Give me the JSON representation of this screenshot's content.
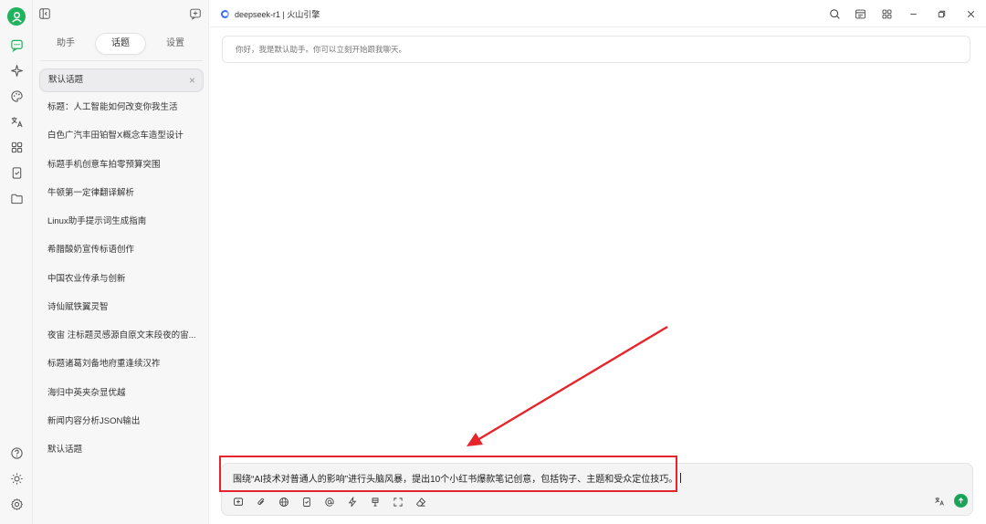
{
  "titlebar": {
    "model_name": "deepseek-r1 | 火山引擎",
    "model_dot_color": "#3b6cf6"
  },
  "sidebar": {
    "tabs": [
      {
        "label": "助手"
      },
      {
        "label": "话题",
        "active": true
      },
      {
        "label": "设置"
      }
    ],
    "topics": [
      {
        "label": "默认话题",
        "active": true
      },
      {
        "label": "标题：人工智能如何改变你我生活"
      },
      {
        "label": "白色广汽丰田铂智X概念车造型设计"
      },
      {
        "label": "标题手机创意车拍零预算突围"
      },
      {
        "label": "牛顿第一定律翻译解析"
      },
      {
        "label": "Linux助手提示词生成指南"
      },
      {
        "label": "希腊酸奶宣传标语创作"
      },
      {
        "label": "中国农业传承与创新"
      },
      {
        "label": "诗仙赋铁翼灵智"
      },
      {
        "label": "夜宙 注标题灵感源自原文末段夜的宙..."
      },
      {
        "label": "标题诸葛刘备地府重逢续汉祚"
      },
      {
        "label": "海归中英夹杂显优越"
      },
      {
        "label": "新闻内容分析JSON输出"
      },
      {
        "label": "默认话题"
      }
    ],
    "close_symbol": "×"
  },
  "chat": {
    "welcome_message": "你好，我是默认助手。你可以立刻开始跟我聊天。"
  },
  "input": {
    "value": "围绕“AI技术对普通人的影响”进行头脑风暴，提出10个小红书爆款笔记创意，包括钩子、主题和受众定位技巧。"
  },
  "icons": {
    "rail": [
      "avatar-icon",
      "chat-icon",
      "sparkle-icon",
      "palette-icon",
      "translate-icon",
      "apps-grid-icon",
      "mini-app-icon",
      "folder-icon",
      "help-icon",
      "theme-sun-icon",
      "settings-gear-icon"
    ],
    "titlebar": [
      "search-icon",
      "layout-icon",
      "grid-icon",
      "minimize-icon",
      "restore-icon",
      "close-icon"
    ],
    "toolbar": [
      "new-topic-icon",
      "attachment-icon",
      "web-search-icon",
      "knowledge-icon",
      "mention-icon",
      "quick-phrase-icon",
      "clear-context-icon",
      "expand-icon",
      "eraser-icon"
    ]
  },
  "colors": {
    "accent_green": "#20b35e",
    "send_green": "#19a45a",
    "annotation_red": "#e5242b"
  }
}
